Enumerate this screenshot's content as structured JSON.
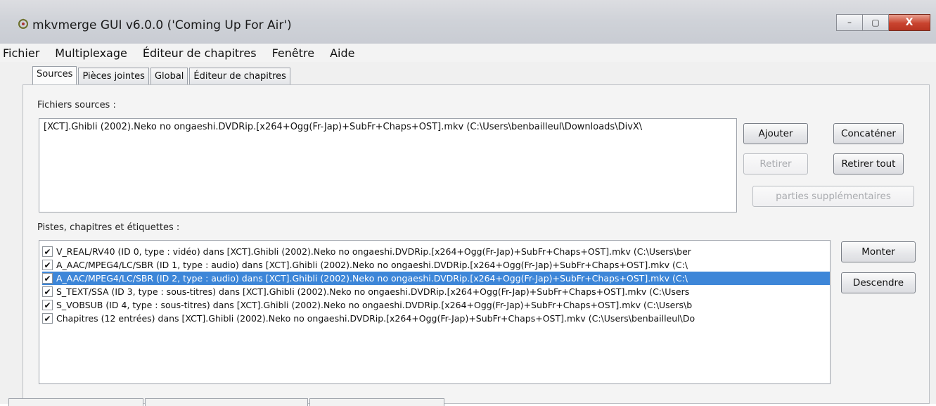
{
  "window": {
    "title": "mkvmerge GUI v6.0.0 ('Coming Up For Air')",
    "controls": {
      "minimize": "–",
      "maximize": "▢",
      "close": "X"
    }
  },
  "menubar": {
    "items": [
      "Fichier",
      "Multiplexage",
      "Éditeur de chapitres",
      "Fenêtre",
      "Aide"
    ]
  },
  "tabs": [
    "Sources",
    "Pièces jointes",
    "Global",
    "Éditeur de chapitres"
  ],
  "sources": {
    "label": "Fichiers sources :",
    "files": [
      "[XCT].Ghibli (2002).Neko no ongaeshi.DVDRip.[x264+Ogg(Fr-Jap)+SubFr+Chaps+OST].mkv (C:\\Users\\benbailleul\\Downloads\\DivX\\"
    ],
    "buttons": {
      "add": "Ajouter",
      "concat": "Concaténer",
      "remove": "Retirer",
      "remove_all": "Retirer tout",
      "additional_parts": "parties supplémentaires"
    }
  },
  "tracks": {
    "label": "Pistes, chapitres et étiquettes :",
    "items": [
      {
        "checked": true,
        "selected": false,
        "text": "V_REAL/RV40 (ID 0, type : vidéo) dans [XCT].Ghibli (2002).Neko no ongaeshi.DVDRip.[x264+Ogg(Fr-Jap)+SubFr+Chaps+OST].mkv (C:\\Users\\ber"
      },
      {
        "checked": true,
        "selected": false,
        "text": "A_AAC/MPEG4/LC/SBR (ID 1, type : audio) dans [XCT].Ghibli (2002).Neko no ongaeshi.DVDRip.[x264+Ogg(Fr-Jap)+SubFr+Chaps+OST].mkv (C:\\"
      },
      {
        "checked": true,
        "selected": true,
        "text": "A_AAC/MPEG4/LC/SBR (ID 2, type : audio) dans [XCT].Ghibli (2002).Neko no ongaeshi.DVDRip.[x264+Ogg(Fr-Jap)+SubFr+Chaps+OST].mkv (C:\\"
      },
      {
        "checked": true,
        "selected": false,
        "text": "S_TEXT/SSA (ID 3, type : sous-titres) dans [XCT].Ghibli (2002).Neko no ongaeshi.DVDRip.[x264+Ogg(Fr-Jap)+SubFr+Chaps+OST].mkv (C:\\Users"
      },
      {
        "checked": true,
        "selected": false,
        "text": "S_VOBSUB (ID 4, type : sous-titres) dans [XCT].Ghibli (2002).Neko no ongaeshi.DVDRip.[x264+Ogg(Fr-Jap)+SubFr+Chaps+OST].mkv (C:\\Users\\b"
      },
      {
        "checked": true,
        "selected": false,
        "text": "Chapitres (12 entrées) dans [XCT].Ghibli (2002).Neko no ongaeshi.DVDRip.[x264+Ogg(Fr-Jap)+SubFr+Chaps+OST].mkv (C:\\Users\\benbailleul\\Do"
      }
    ],
    "buttons": {
      "up": "Monter",
      "down": "Descendre"
    }
  },
  "colors": {
    "selection": "#3d86d8",
    "title_bar": "#cfd2d8",
    "close_button": "#c9442f"
  }
}
